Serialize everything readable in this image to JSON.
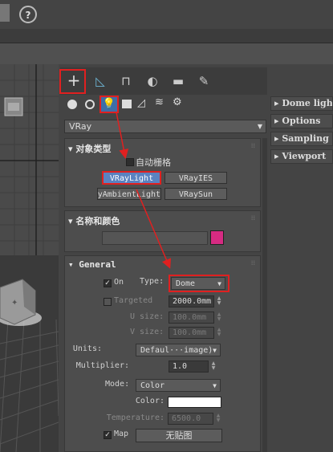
{
  "toolbar": {
    "save_icon": "save-icon",
    "help_label": "?"
  },
  "command_panel": {
    "tabs": [
      {
        "icon": "create-icon",
        "glyph": "+"
      },
      {
        "icon": "modify-icon",
        "glyph": "◺"
      },
      {
        "icon": "hierarchy-icon",
        "glyph": "⊓"
      },
      {
        "icon": "motion-icon",
        "glyph": "◐"
      },
      {
        "icon": "display-icon",
        "glyph": "▬"
      },
      {
        "icon": "utilities-icon",
        "glyph": "✎"
      }
    ],
    "category_icons": [
      "geometry",
      "shapes",
      "lights",
      "cameras",
      "helpers",
      "space-warps",
      "systems"
    ],
    "renderer_dropdown": "VRay"
  },
  "object_type": {
    "title": "对象类型",
    "autogrid_label": "自动栅格",
    "buttons": [
      "VRayLight",
      "VRayIES",
      "VRayAmbientLight",
      "VRaySun"
    ]
  },
  "name_color": {
    "title": "名称和颜色",
    "swatch_color": "#d62b82"
  },
  "general": {
    "title": "General",
    "on_label": "On",
    "type_label": "Type:",
    "type_value": "Dome",
    "targeted_label": "Targeted",
    "targeted_value": "2000.0mm",
    "usize_label": "U size:",
    "usize_value": "100.0mm",
    "vsize_label": "V size:",
    "vsize_value": "100.0mm",
    "units_label": "Units:",
    "units_value": "Defaul···image)",
    "multiplier_label": "Multiplier:",
    "multiplier_value": "1.0",
    "mode_label": "Mode:",
    "mode_value": "Color",
    "color_label": "Color:",
    "temperature_label": "Temperature:",
    "temperature_value": "6500.0",
    "map_label": "Map",
    "map_button": "无贴图"
  },
  "right_rollouts": [
    "Dome light",
    "Options",
    "Sampling",
    "Viewport"
  ],
  "colors": {
    "highlight": "#e02020",
    "selected_button": "#5a82c0",
    "swatch": "#d62b82"
  }
}
